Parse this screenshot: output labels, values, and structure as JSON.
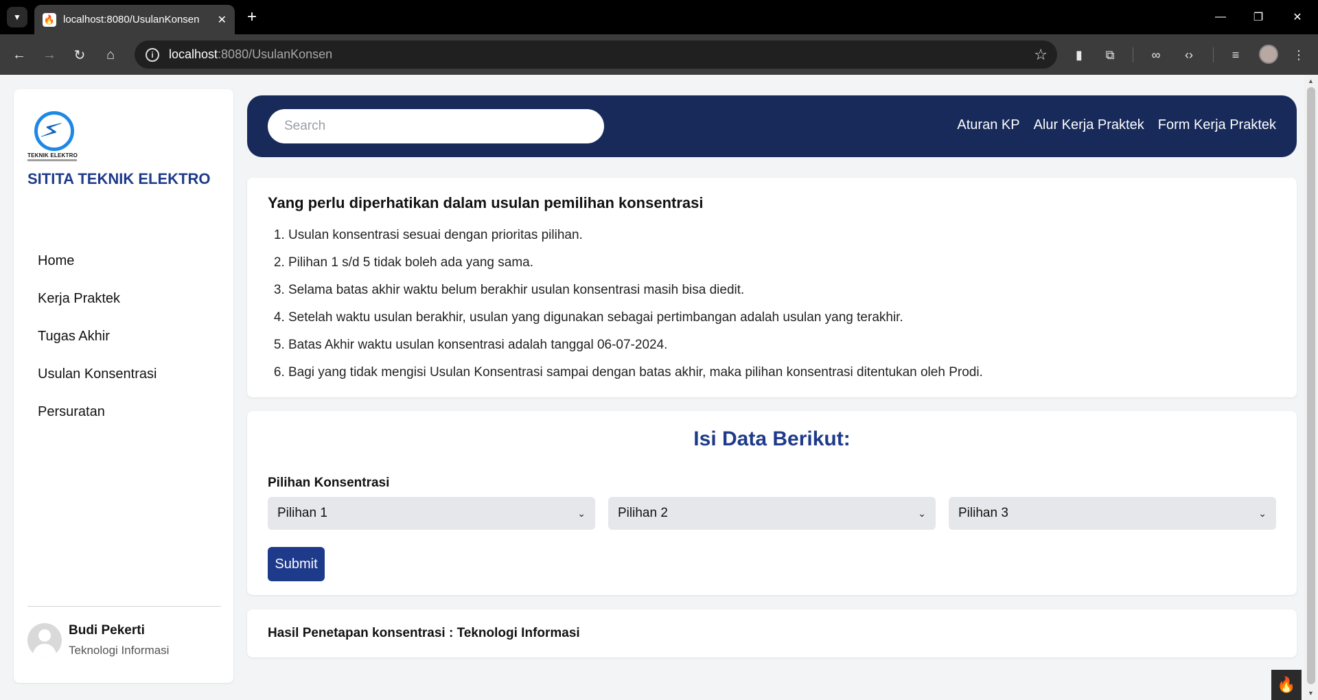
{
  "browser": {
    "tab_title": "localhost:8080/UsulanKonsen",
    "tab_favicon": "flame-icon",
    "url_host": "localhost",
    "url_path": ":8080/UsulanKonsen"
  },
  "sidebar": {
    "logo_text": "TEKNIK ELEKTRO",
    "brand": "SITITA TEKNIK ELEKTRO",
    "items": [
      {
        "label": "Home"
      },
      {
        "label": "Kerja Praktek"
      },
      {
        "label": "Tugas Akhir"
      },
      {
        "label": "Usulan Konsentrasi"
      },
      {
        "label": "Persuratan"
      }
    ],
    "user": {
      "name": "Budi Pekerti",
      "role": "Teknologi Informasi"
    }
  },
  "topnav": {
    "search_placeholder": "Search",
    "links": [
      "Aturan KP",
      "Alur Kerja Praktek",
      "Form Kerja Praktek"
    ]
  },
  "notice": {
    "title": "Yang perlu diperhatikan dalam usulan pemilihan konsentrasi",
    "items": [
      "Usulan konsentrasi sesuai dengan prioritas pilihan.",
      "Pilihan 1 s/d 5 tidak boleh ada yang sama.",
      "Selama batas akhir waktu belum berakhir usulan konsentrasi masih bisa diedit.",
      "Setelah waktu usulan berakhir, usulan yang digunakan sebagai pertimbangan adalah usulan yang terakhir.",
      "Batas Akhir waktu usulan konsentrasi adalah tanggal 06-07-2024.",
      "Bagi yang tidak mengisi Usulan Konsentrasi sampai dengan batas akhir, maka pilihan konsentrasi ditentukan oleh Prodi."
    ]
  },
  "form": {
    "title": "Isi Data Berikut:",
    "label": "Pilihan Konsentrasi",
    "selects": [
      "Pilihan 1",
      "Pilihan 2",
      "Pilihan 3"
    ],
    "submit_label": "Submit"
  },
  "result": {
    "text": "Hasil Penetapan konsentrasi : Teknologi Informasi"
  },
  "colors": {
    "accent": "#1e3a8a",
    "navbar": "#172a5a"
  }
}
